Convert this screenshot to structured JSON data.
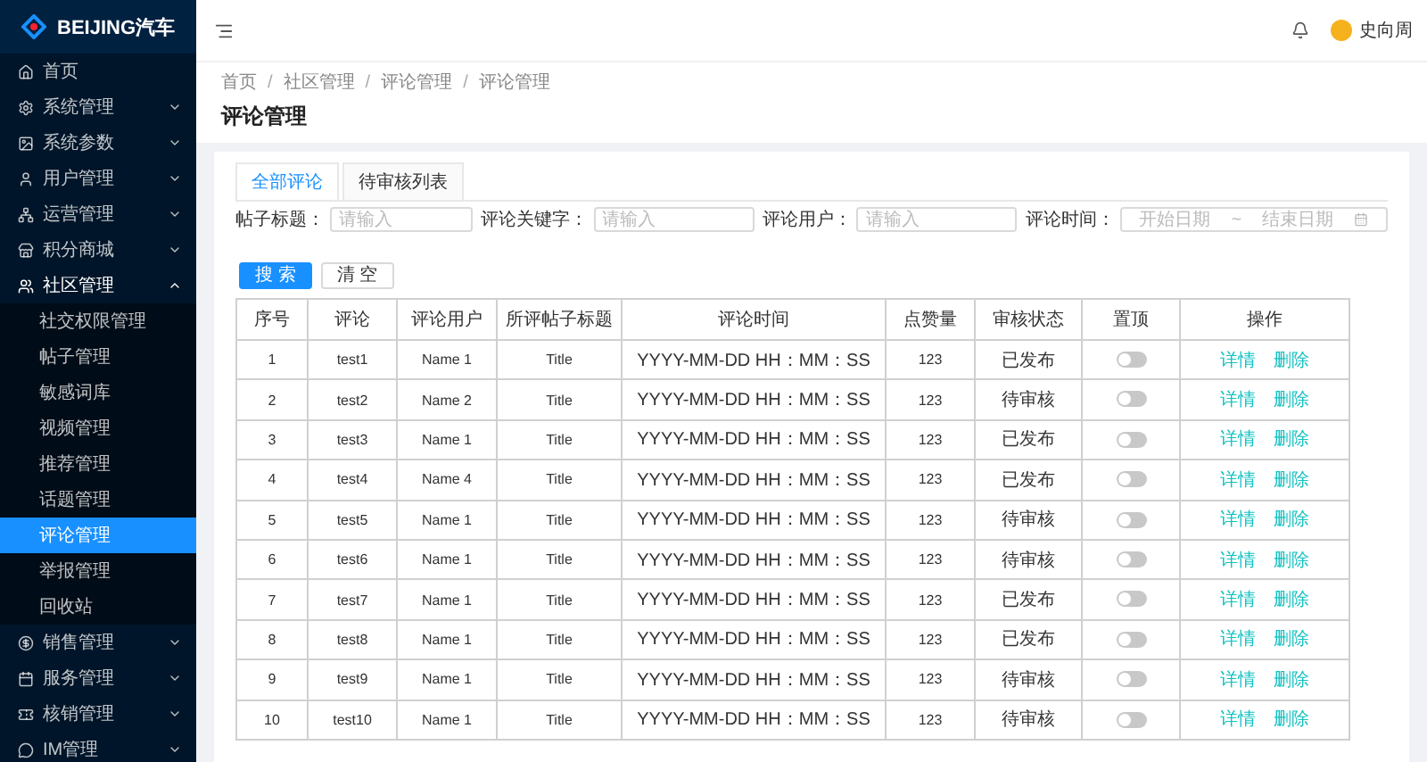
{
  "brand": {
    "name": "BEIJING汽车"
  },
  "sidebar": {
    "items": [
      {
        "label": "首页",
        "expandable": false,
        "expanded": false
      },
      {
        "label": "系统管理",
        "expandable": true,
        "expanded": false
      },
      {
        "label": "系统参数",
        "expandable": true,
        "expanded": false
      },
      {
        "label": "用户管理",
        "expandable": true,
        "expanded": false
      },
      {
        "label": "运营管理",
        "expandable": true,
        "expanded": false
      },
      {
        "label": "积分商城",
        "expandable": true,
        "expanded": false
      },
      {
        "label": "社区管理",
        "expandable": true,
        "expanded": true,
        "children": [
          {
            "label": "社交权限管理",
            "selected": false
          },
          {
            "label": "帖子管理",
            "selected": false
          },
          {
            "label": "敏感词库",
            "selected": false
          },
          {
            "label": "视频管理",
            "selected": false
          },
          {
            "label": "推荐管理",
            "selected": false
          },
          {
            "label": "话题管理",
            "selected": false
          },
          {
            "label": "评论管理",
            "selected": true
          },
          {
            "label": "举报管理",
            "selected": false
          },
          {
            "label": "回收站",
            "selected": false
          }
        ]
      },
      {
        "label": "销售管理",
        "expandable": true,
        "expanded": false
      },
      {
        "label": "服务管理",
        "expandable": true,
        "expanded": false
      },
      {
        "label": "核销管理",
        "expandable": true,
        "expanded": false
      },
      {
        "label": "IM管理",
        "expandable": true,
        "expanded": false
      }
    ]
  },
  "header": {
    "user": "史向周"
  },
  "breadcrumb": [
    "首页",
    "社区管理",
    "评论管理",
    "评论管理"
  ],
  "breadcrumb_separator": "/",
  "page_title": "评论管理",
  "tabs": [
    {
      "label": "全部评论",
      "selected": true
    },
    {
      "label": "待审核列表",
      "selected": false
    }
  ],
  "filters": [
    {
      "kind": "text",
      "label": "帖子标题：",
      "placeholder": "请输入"
    },
    {
      "kind": "text",
      "label": "评论关键字：",
      "placeholder": "请输入"
    },
    {
      "kind": "text",
      "label": "评论用户：",
      "placeholder": "请输入"
    },
    {
      "kind": "daterange",
      "label": "评论时间：",
      "start_placeholder": "开始日期",
      "separator": "~",
      "end_placeholder": "结束日期"
    }
  ],
  "buttons": [
    {
      "label": "搜 索",
      "kind": "primary"
    },
    {
      "label": "清 空",
      "kind": "default"
    }
  ],
  "table": {
    "columns": [
      "序号",
      "评论",
      "评论用户",
      "所评帖子标题",
      "评论时间",
      "点赞量",
      "审核状态",
      "置顶",
      "操作"
    ],
    "rows": [
      {
        "no": "1",
        "comment": "test1",
        "user": "Name 1",
        "post": "Title",
        "time": "YYYY-MM-DD  HH：MM：SS",
        "likes": "123",
        "status": "已发布",
        "pinned": false,
        "actions": [
          "详情",
          "删除"
        ]
      },
      {
        "no": "2",
        "comment": "test2",
        "user": "Name 2",
        "post": "Title",
        "time": "YYYY-MM-DD  HH：MM：SS",
        "likes": "123",
        "status": "待审核",
        "pinned": false,
        "actions": [
          "详情",
          "删除"
        ]
      },
      {
        "no": "3",
        "comment": "test3",
        "user": "Name 1",
        "post": "Title",
        "time": "YYYY-MM-DD  HH：MM：SS",
        "likes": "123",
        "status": "已发布",
        "pinned": false,
        "actions": [
          "详情",
          "删除"
        ]
      },
      {
        "no": "4",
        "comment": "test4",
        "user": "Name 4",
        "post": "Title",
        "time": "YYYY-MM-DD  HH：MM：SS",
        "likes": "123",
        "status": "已发布",
        "pinned": false,
        "actions": [
          "详情",
          "删除"
        ]
      },
      {
        "no": "5",
        "comment": "test5",
        "user": "Name 1",
        "post": "Title",
        "time": "YYYY-MM-DD  HH：MM：SS",
        "likes": "123",
        "status": "待审核",
        "pinned": false,
        "actions": [
          "详情",
          "删除"
        ]
      },
      {
        "no": "6",
        "comment": "test6",
        "user": "Name 1",
        "post": "Title",
        "time": "YYYY-MM-DD  HH：MM：SS",
        "likes": "123",
        "status": "待审核",
        "pinned": false,
        "actions": [
          "详情",
          "删除"
        ]
      },
      {
        "no": "7",
        "comment": "test7",
        "user": "Name 1",
        "post": "Title",
        "time": "YYYY-MM-DD  HH：MM：SS",
        "likes": "123",
        "status": "已发布",
        "pinned": false,
        "actions": [
          "详情",
          "删除"
        ]
      },
      {
        "no": "8",
        "comment": "test8",
        "user": "Name 1",
        "post": "Title",
        "time": "YYYY-MM-DD  HH：MM：SS",
        "likes": "123",
        "status": "已发布",
        "pinned": false,
        "actions": [
          "详情",
          "删除"
        ]
      },
      {
        "no": "9",
        "comment": "test9",
        "user": "Name 1",
        "post": "Title",
        "time": "YYYY-MM-DD  HH：MM：SS",
        "likes": "123",
        "status": "待审核",
        "pinned": false,
        "actions": [
          "详情",
          "删除"
        ]
      },
      {
        "no": "10",
        "comment": "test10",
        "user": "Name 1",
        "post": "Title",
        "time": "YYYY-MM-DD  HH：MM：SS",
        "likes": "123",
        "status": "待审核",
        "pinned": false,
        "actions": [
          "详情",
          "删除"
        ]
      }
    ]
  }
}
